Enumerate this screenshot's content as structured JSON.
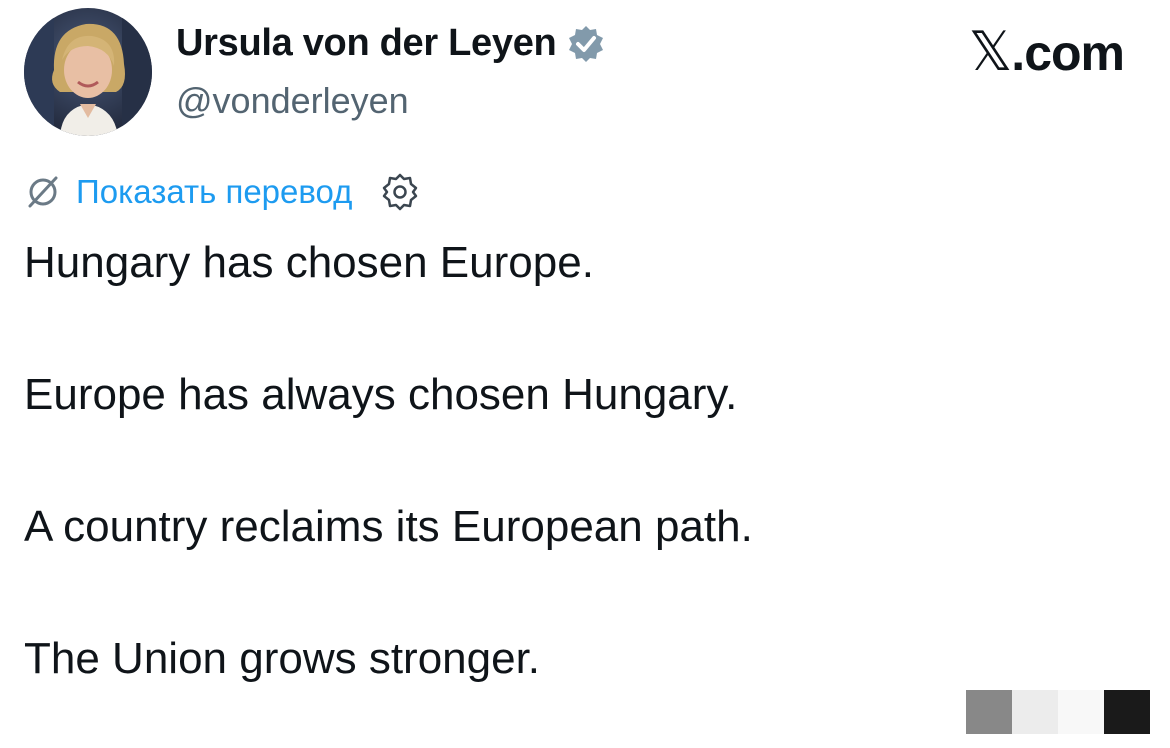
{
  "author": {
    "display_name": "Ursula von der Leyen",
    "handle": "@vonderleyen",
    "verified": true,
    "verified_color": "#829aab"
  },
  "brand": {
    "x_glyph": "𝕏",
    "suffix": ".com"
  },
  "translate": {
    "label": "Показать перевод",
    "link_color": "#1d9bf0"
  },
  "tweet": {
    "lines": [
      "Hungary has chosen Europe.",
      "Europe has always chosen Hungary.",
      "A country reclaims its European path.",
      "The Union grows stronger."
    ]
  },
  "icons": {
    "verified": "verified-badge-icon",
    "translate": "translate-icon",
    "settings": "gear-icon"
  }
}
